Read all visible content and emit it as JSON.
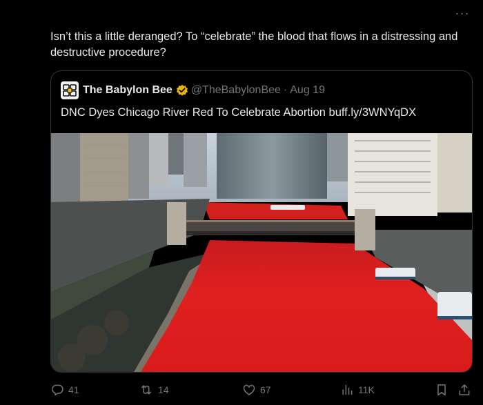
{
  "tweet": {
    "text": "Isn’t this a little deranged? To “celebrate” the blood that flows in a distressing and destructive procedure?"
  },
  "quote": {
    "name": "The Babylon Bee",
    "handle": "@TheBabylonBee",
    "separator": "·",
    "date": "Aug 19",
    "text": "DNC Dyes Chicago River Red To Celebrate Abortion buff.ly/3WNYqDX"
  },
  "actions": {
    "replies": "41",
    "reposts": "14",
    "likes": "67",
    "views": "11K"
  },
  "colors": {
    "background": "#000000",
    "text": "#e7e9ea",
    "muted": "#71767b",
    "border": "#2f3336",
    "verified": "#e8b40c",
    "river": "#e0201f"
  },
  "icons": [
    "more-icon",
    "babylon-bee-logo",
    "verified-badge-icon",
    "reply-icon",
    "repost-icon",
    "like-icon",
    "views-icon",
    "bookmark-icon",
    "share-icon"
  ]
}
